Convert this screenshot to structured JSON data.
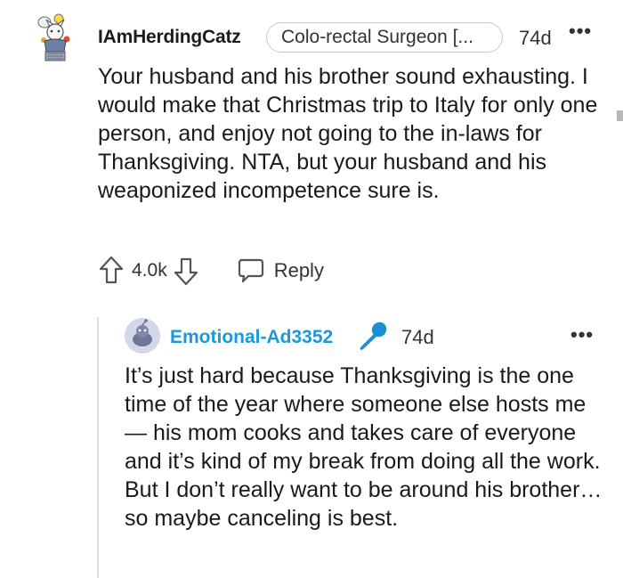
{
  "comment": {
    "username": "IAmHerdingCatz",
    "flair": "Colo-rectal Surgeon [...",
    "time": "74d",
    "more": "•••",
    "body": "Your husband and his brother sound exhausting. I would make that Christmas trip to Italy for only one person, and enjoy not going to the in-laws for Thanksgiving. NTA, but your husband and his weaponized incompetence sure is.",
    "score": "4.0k",
    "reply_label": "Reply"
  },
  "reply": {
    "username": "Emotional-Ad3352",
    "time": "74d",
    "more": "•••",
    "body": "It’s just hard because Thanksgiving is the one time of the year where someone else hosts me — his mom cooks and takes care of everyone and it’s kind of my break from doing all the work. But I don’t really want to be around his brother… so maybe canceling is best."
  },
  "colors": {
    "reply_username": "#1b9ad8",
    "mic": "#1b8fd6",
    "text": "#1a1a1b"
  },
  "icons": {
    "upvote": "arrow-up-outline-icon",
    "downvote": "arrow-down-outline-icon",
    "reply": "speech-bubble-icon",
    "mic": "microphone-icon"
  }
}
